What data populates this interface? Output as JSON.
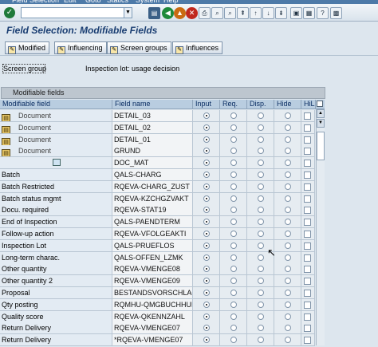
{
  "menu": [
    "Field Selection",
    "Edit",
    "Goto",
    "Statics",
    "System",
    "Help"
  ],
  "toolbar": {
    "command_value": "",
    "buttons": [
      {
        "name": "enter-icon",
        "glyph": "✓",
        "color": "#1f7a3a"
      },
      {
        "name": "save-icon",
        "glyph": "▤",
        "color": "#3a5f86"
      },
      {
        "name": "back-icon",
        "glyph": "◀",
        "color": "#1e8a3a"
      },
      {
        "name": "exit-icon",
        "glyph": "▲",
        "color": "#c96b12"
      },
      {
        "name": "cancel-icon",
        "glyph": "✕",
        "color": "#c0281e"
      },
      {
        "name": "print-icon",
        "glyph": "⎙",
        "color": "#55667a"
      },
      {
        "name": "find-icon",
        "glyph": "⌕",
        "color": "#55667a"
      },
      {
        "name": "find-next-icon",
        "glyph": "⌕",
        "color": "#55667a"
      },
      {
        "name": "first-page-icon",
        "glyph": "⇞",
        "color": "#55667a"
      },
      {
        "name": "previous-page-icon",
        "glyph": "↑",
        "color": "#55667a"
      },
      {
        "name": "next-page-icon",
        "glyph": "↓",
        "color": "#55667a"
      },
      {
        "name": "last-page-icon",
        "glyph": "⇟",
        "color": "#55667a"
      },
      {
        "name": "new-session-icon",
        "glyph": "▣",
        "color": "#2f6fa8"
      },
      {
        "name": "shortcut-icon",
        "glyph": "▦",
        "color": "#2f6fa8"
      },
      {
        "name": "help-icon",
        "glyph": "?",
        "color": "#c96b12"
      },
      {
        "name": "layout-icon",
        "glyph": "▩",
        "color": "#2f6fa8"
      }
    ]
  },
  "page": {
    "title": "Field Selection: Modifiable Fields"
  },
  "app_toolbar": [
    {
      "label": "Modified"
    },
    {
      "label": "Influencing"
    },
    {
      "label": "Screen groups"
    },
    {
      "label": "Influences"
    }
  ],
  "screen_group": {
    "button": "Screen group",
    "value": "Inspection lot: usage decision"
  },
  "frame": {
    "title": "Modifiable fields"
  },
  "columns": [
    "Modifiable field",
    "Field name",
    "Input",
    "Req.",
    "Disp.",
    "Hide",
    "HiLi"
  ],
  "rows": [
    {
      "type": "doc",
      "mod": "Document",
      "field": "DETAIL_03",
      "sel": 0
    },
    {
      "type": "doc",
      "mod": "Document",
      "field": "DETAIL_02",
      "sel": 0
    },
    {
      "type": "doc",
      "mod": "Document",
      "field": "DETAIL_01",
      "sel": 0
    },
    {
      "type": "doc",
      "mod": "Document",
      "field": "GRUND",
      "sel": 0
    },
    {
      "type": "icon",
      "mod": "",
      "field": "DOC_MAT",
      "sel": 0
    },
    {
      "type": "text",
      "mod": "Batch",
      "field": "QALS-CHARG",
      "sel": 0
    },
    {
      "type": "text",
      "mod": "Batch Restricted",
      "field": "RQEVA-CHARG_ZUST",
      "sel": 0
    },
    {
      "type": "text",
      "mod": "Batch status mgmt",
      "field": "RQEVA-KZCHGZVAKT",
      "sel": 0
    },
    {
      "type": "text",
      "mod": "Docu. required",
      "field": "RQEVA-STAT19",
      "sel": 0
    },
    {
      "type": "text",
      "mod": "End of Inspection",
      "field": "QALS-PAENDTERM",
      "sel": 0
    },
    {
      "type": "text",
      "mod": "Follow-up action",
      "field": "RQEVA-VFOLGEAKTI",
      "sel": 0
    },
    {
      "type": "text",
      "mod": "Inspection Lot",
      "field": "QALS-PRUEFLOS",
      "sel": 0
    },
    {
      "type": "text",
      "mod": "Long-term charac.",
      "field": "QALS-OFFEN_LZMK",
      "sel": 0
    },
    {
      "type": "text",
      "mod": "Other quantity",
      "field": "RQEVA-VMENGE08",
      "sel": 0
    },
    {
      "type": "text",
      "mod": "Other quantity 2",
      "field": "RQEVA-VMENGE09",
      "sel": 0
    },
    {
      "type": "text",
      "mod": "Proposal",
      "field": "BESTANDSVORSCHLAG",
      "sel": 0
    },
    {
      "type": "text",
      "mod": "Qty posting",
      "field": "RQMHU-QMGBUCHHUM",
      "sel": 0
    },
    {
      "type": "text",
      "mod": "Quality score",
      "field": "RQEVA-QKENNZAHL",
      "sel": 0
    },
    {
      "type": "text",
      "mod": "Return Delivery",
      "field": "RQEVA-VMENGE07",
      "sel": 0
    },
    {
      "type": "text",
      "mod": "Return Delivery",
      "field": "*RQEVA-VMENGE07",
      "sel": 0
    }
  ]
}
